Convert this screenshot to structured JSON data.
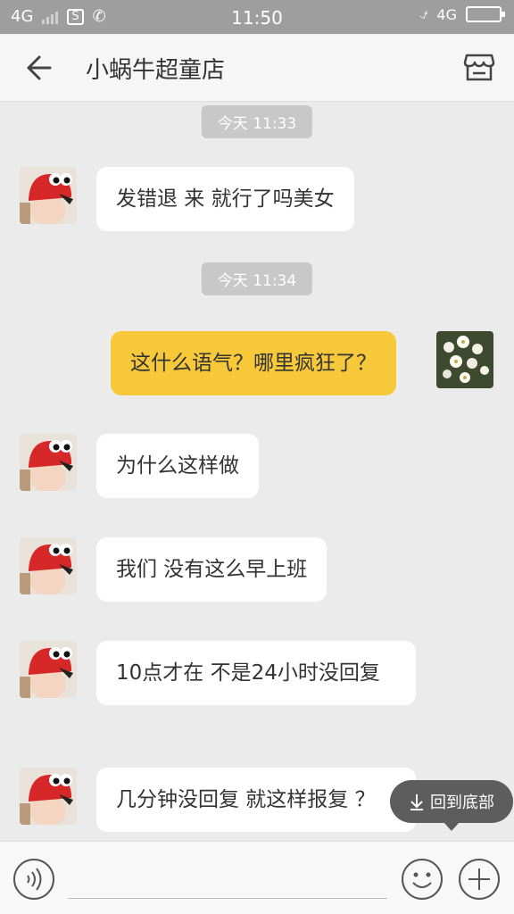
{
  "status_bar": {
    "network_left": "4G",
    "sim_icon_text": "S",
    "time": "11:50",
    "network_right": "4G"
  },
  "header": {
    "title": "小蜗牛超童店",
    "back_icon": "back-arrow-icon",
    "shop_icon": "store-icon"
  },
  "messages": [
    {
      "type": "timestamp",
      "text": "今天 11:33"
    },
    {
      "type": "incoming",
      "text": "发错退 来 就行了吗美女"
    },
    {
      "type": "timestamp",
      "text": "今天 11:34"
    },
    {
      "type": "outgoing",
      "text": "这什么语气？哪里疯狂了？"
    },
    {
      "type": "incoming",
      "text": "为什么这样做"
    },
    {
      "type": "incoming",
      "text": "我们 没有这么早上班"
    },
    {
      "type": "incoming",
      "text": "10点才在  不是24小时没回复"
    },
    {
      "type": "incoming",
      "text": "几分钟没回复 就这样报复 ？"
    }
  ],
  "scroll_to_bottom": {
    "label": "回到底部"
  },
  "input_bar": {
    "value": ""
  },
  "colors": {
    "outgoing_bubble": "#f7c93a",
    "incoming_bubble": "#ffffff",
    "chat_background": "#ebebeb"
  }
}
